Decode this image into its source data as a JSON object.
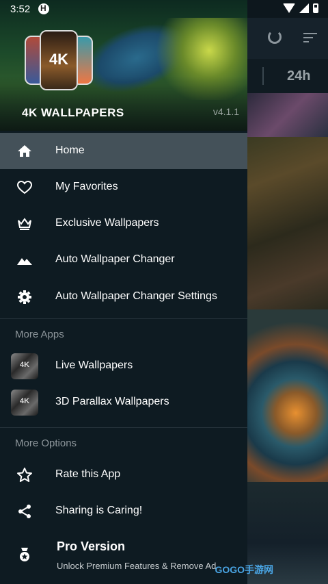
{
  "status_bar": {
    "time": "3:52"
  },
  "header": {
    "app_name": "4K WALLPAPERS",
    "version": "v4.1.1",
    "logo_text": "4K"
  },
  "menu": {
    "items": [
      {
        "label": "Home",
        "icon": "home-icon"
      },
      {
        "label": "My Favorites",
        "icon": "heart-icon"
      },
      {
        "label": "Exclusive Wallpapers",
        "icon": "crown-icon"
      },
      {
        "label": "Auto Wallpaper Changer",
        "icon": "landscape-icon"
      },
      {
        "label": "Auto Wallpaper Changer Settings",
        "icon": "gear-icon"
      }
    ],
    "more_apps_title": "More Apps",
    "more_apps": [
      {
        "label": "Live Wallpapers",
        "thumb": "4K"
      },
      {
        "label": "3D Parallax Wallpapers",
        "thumb": "4K"
      }
    ],
    "more_options_title": "More Options",
    "options": [
      {
        "label": "Rate this App",
        "icon": "star-icon"
      },
      {
        "label": "Sharing is Caring!",
        "icon": "share-icon"
      }
    ],
    "pro": {
      "title": "Pro Version",
      "subtitle": "Unlock Premium Features & Remove Ad"
    }
  },
  "background": {
    "tab_label": "24h"
  },
  "watermark": "GOGO手游网"
}
